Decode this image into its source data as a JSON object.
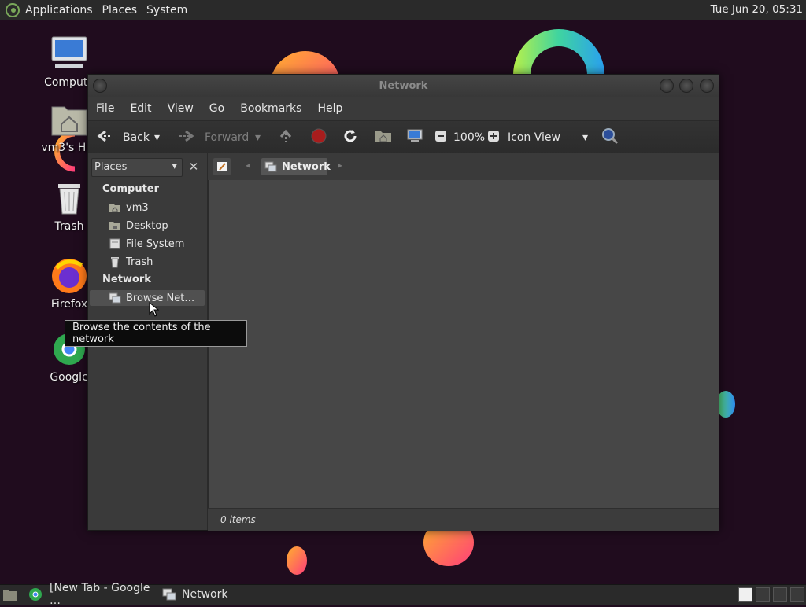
{
  "top_panel": {
    "applications": "Applications",
    "places": "Places",
    "system": "System",
    "clock": "Tue Jun 20, 05:31"
  },
  "desktop_icons": {
    "computer": "Compute",
    "home": "vm3's Hor",
    "trash": "Trash",
    "firefox": "Firefox",
    "chrome": "Google"
  },
  "window": {
    "title": "Network",
    "menu": [
      "File",
      "Edit",
      "View",
      "Go",
      "Bookmarks",
      "Help"
    ],
    "toolbar": {
      "back": "Back",
      "forward": "Forward",
      "zoom": "100%",
      "view_mode": "Icon View"
    },
    "side_pane": {
      "selector": "Places",
      "computer_header": "Computer",
      "items": [
        "vm3",
        "Desktop",
        "File System",
        "Trash"
      ],
      "network_header": "Network",
      "browse_network": "Browse Net…"
    },
    "location": "Network",
    "status": "0 items"
  },
  "tooltip": "Browse the contents of the network",
  "bottom_panel": {
    "task_chrome": "[New Tab - Google …",
    "task_network": "Network"
  },
  "colors": {
    "accent_ring": "#7de06a",
    "blob_orange": "#ff7a3d",
    "background": "#200c1e"
  }
}
